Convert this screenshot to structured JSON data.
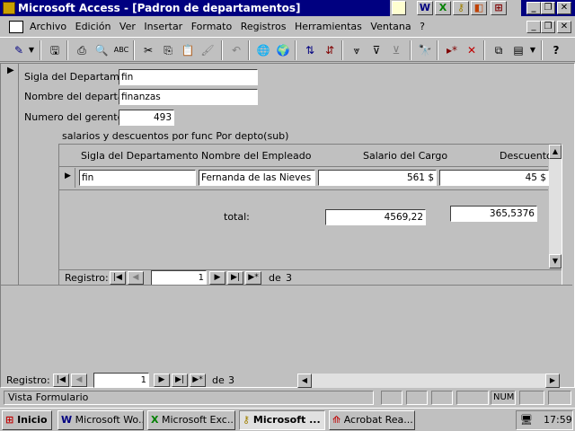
{
  "window": {
    "title": "Microsoft Access - [Padron de departamentos]"
  },
  "office_bar": {
    "icons": [
      "office-document-icon",
      "word-icon",
      "excel-icon",
      "access-key-icon",
      "powerpoint-icon",
      "windows-icon"
    ]
  },
  "menu": {
    "items": [
      "Archivo",
      "Edición",
      "Ver",
      "Insertar",
      "Formato",
      "Registros",
      "Herramientas",
      "Ventana",
      "?"
    ]
  },
  "form": {
    "sigla_label": "Sigla del Departamen",
    "sigla_value": "fin",
    "nombre_label": "Nombre del departam",
    "nombre_value": "finanzas",
    "gerente_label": "Numero del gerente",
    "gerente_value": "493",
    "subform_caption": "salarios y descuentos por func  Por depto(sub)"
  },
  "subform": {
    "headers": [
      "Sigla del Departamento",
      "Nombre del Empleado",
      "Salario del Cargo",
      "Descuento"
    ],
    "row": {
      "sigla": "fin",
      "nombre": "Fernanda de las Nieves",
      "salario": "561 $",
      "descuento": "45 $"
    },
    "total_label": "total:",
    "total_salario": "4569,22",
    "total_descuento": "365,5376",
    "nav": {
      "label": "Registro:",
      "current": "1",
      "of": "de",
      "count": "3"
    }
  },
  "main_nav": {
    "label": "Registro:",
    "current": "1",
    "of": "de",
    "count": "3"
  },
  "status": {
    "text": "Vista Formulario",
    "num": "NUM"
  },
  "taskbar": {
    "start": "Inicio",
    "tasks": [
      "Microsoft Wo...",
      "Microsoft Exc...",
      "Microsoft ...",
      "Acrobat Rea..."
    ],
    "clock": "17:59"
  }
}
